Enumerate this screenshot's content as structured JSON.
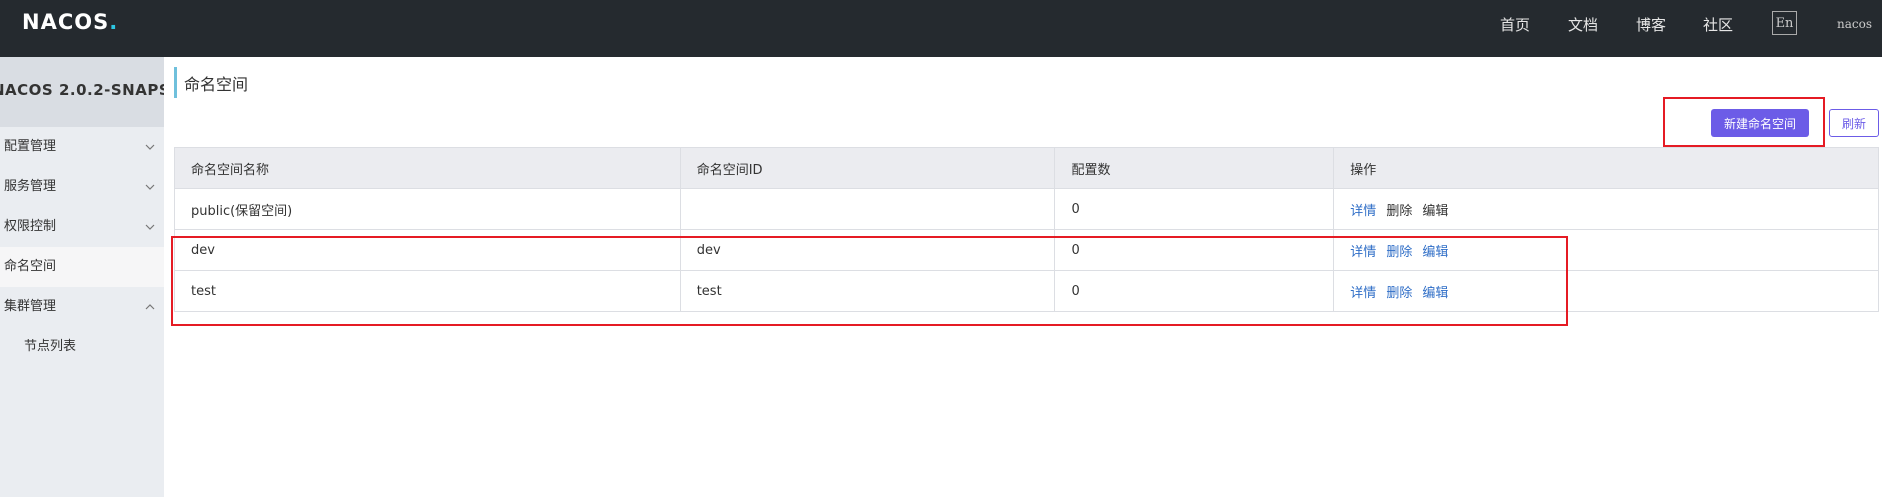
{
  "header": {
    "logo": {
      "n": "N",
      "a": "A",
      "oo": "CO",
      "s": "S",
      "dot": "."
    },
    "nav": [
      "首页",
      "文档",
      "博客",
      "社区"
    ],
    "lang": "En",
    "user": "nacos"
  },
  "sidebar": {
    "title": "NACOS 2.0.2-SNAPS...",
    "items": [
      {
        "label": "配置管理",
        "chevron": "down"
      },
      {
        "label": "服务管理",
        "chevron": "down"
      },
      {
        "label": "权限控制",
        "chevron": "down"
      },
      {
        "label": "命名空间",
        "chevron": "none",
        "active": true
      },
      {
        "label": "集群管理",
        "chevron": "up"
      },
      {
        "label": "节点列表",
        "chevron": "none",
        "sub": true
      }
    ]
  },
  "page": {
    "title": "命名空间",
    "new_button": "新建命名空间",
    "refresh_button": "刷新"
  },
  "table": {
    "headers": [
      "命名空间名称",
      "命名空间ID",
      "配置数",
      "操作"
    ],
    "rows": [
      {
        "name": "public(保留空间)",
        "id": "",
        "count": "0",
        "ops": [
          "详情",
          "删除",
          "编辑"
        ]
      },
      {
        "name": "dev",
        "id": "dev",
        "count": "0",
        "ops": [
          "详情",
          "删除",
          "编辑"
        ]
      },
      {
        "name": "test",
        "id": "test",
        "count": "0",
        "ops": [
          "详情",
          "删除",
          "编辑"
        ]
      }
    ]
  },
  "colors": {
    "topbar": "#252a2f",
    "sidebar": "#eaedf1",
    "primary": "#6c5ce7",
    "link": "#2f6ec7",
    "annotation": "#e51b24"
  }
}
